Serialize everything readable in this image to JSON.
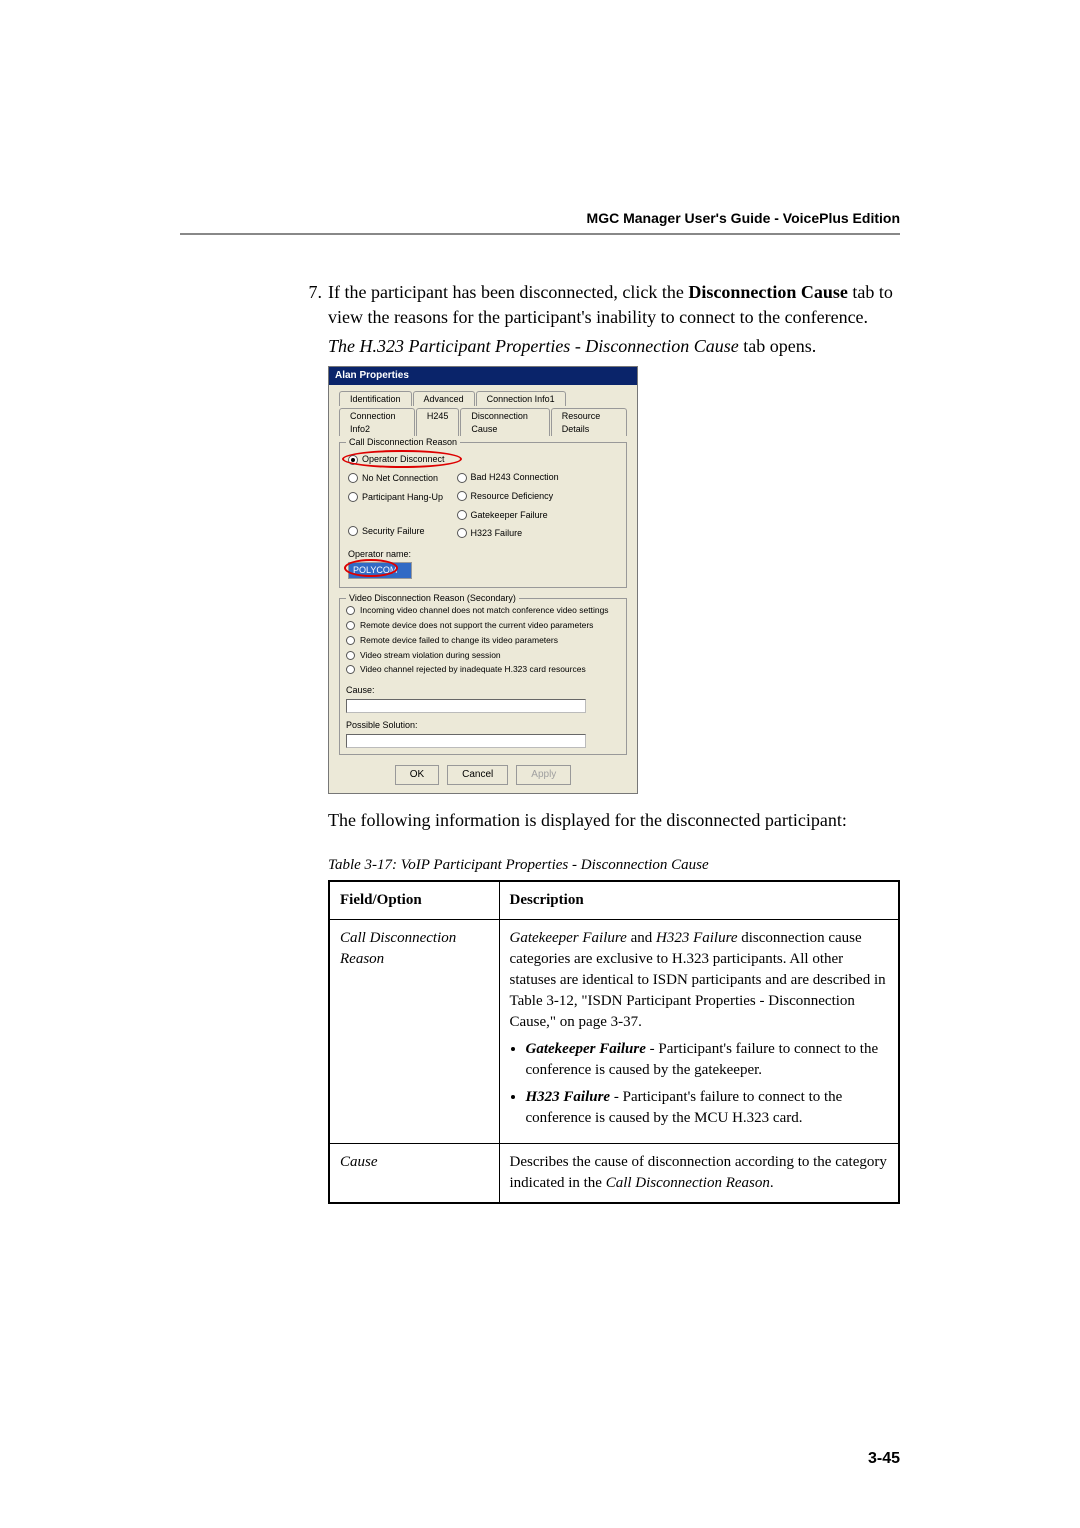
{
  "header": {
    "title": "MGC Manager User's Guide - VoicePlus Edition"
  },
  "step": {
    "number": "7.",
    "text_prefix": "If the participant has been disconnected, click the ",
    "text_bold": "Disconnection Cause",
    "text_suffix": " tab to view the reasons for the participant's inability to connect to the conference.",
    "caption_prefix": "The ",
    "caption_italic": "H.323 Participant Properties - Disconnection Cause",
    "caption_suffix": " tab opens."
  },
  "dialog": {
    "title": "Alan Properties",
    "tabs_row1": [
      "Identification",
      "Advanced",
      "Connection Info1"
    ],
    "tabs_row2": [
      "Connection Info2",
      "H245",
      "Disconnection Cause",
      "Resource Details"
    ],
    "active_tab": "Disconnection Cause",
    "cdr_legend": "Call Disconnection Reason",
    "radios_left": [
      "Operator Disconnect",
      "No Net Connection",
      "Participant Hang-Up",
      "Security Failure"
    ],
    "radios_right": [
      "Bad H243 Connection",
      "Resource Deficiency",
      "Gatekeeper Failure",
      "H323 Failure"
    ],
    "radios_checked": "Operator Disconnect",
    "operator_name_label": "Operator name:",
    "operator_name_value": "POLYCOM",
    "secondary_legend": "Video Disconnection Reason (Secondary)",
    "secondary_items": [
      "Incoming video channel does not match conference video settings",
      "Remote device does not support the current video parameters",
      "Remote device failed to change its video parameters",
      "Video stream violation during session",
      "Video channel rejected by inadequate H.323 card resources"
    ],
    "cause_label": "Cause:",
    "possible_solution_label": "Possible Solution:",
    "buttons": {
      "ok": "OK",
      "cancel": "Cancel",
      "apply": "Apply"
    }
  },
  "body_text": "The following information is displayed for the disconnected participant:",
  "table": {
    "caption": "Table 3-17: VoIP Participant Properties - Disconnection Cause",
    "header": {
      "field": "Field/Option",
      "desc": "Description"
    },
    "rows": [
      {
        "field": "Call Disconnection Reason",
        "desc_intro_i1": "Gatekeeper Failure",
        "desc_intro_and": " and ",
        "desc_intro_i2": "H323 Failure",
        "desc_intro_rest": " disconnection cause categories are exclusive to H.323 participants. All other statuses are identical to ISDN participants and are described in Table 3-12, \"ISDN Participant Properties - Disconnection Cause,\" on page 3-37.",
        "bullets": [
          {
            "lead": "Gatekeeper Failure",
            "rest": " - Participant's failure to connect to the conference is caused by the gatekeeper."
          },
          {
            "lead": "H323 Failure",
            "rest": " - Participant's failure to connect to the conference is caused by the MCU H.323 card."
          }
        ]
      },
      {
        "field": "Cause",
        "desc_plain_pre": "Describes the cause of disconnection according to the category indicated in the ",
        "desc_plain_ital": "Call Disconnection Reason",
        "desc_plain_post": "."
      }
    ]
  },
  "page_number": "3-45"
}
